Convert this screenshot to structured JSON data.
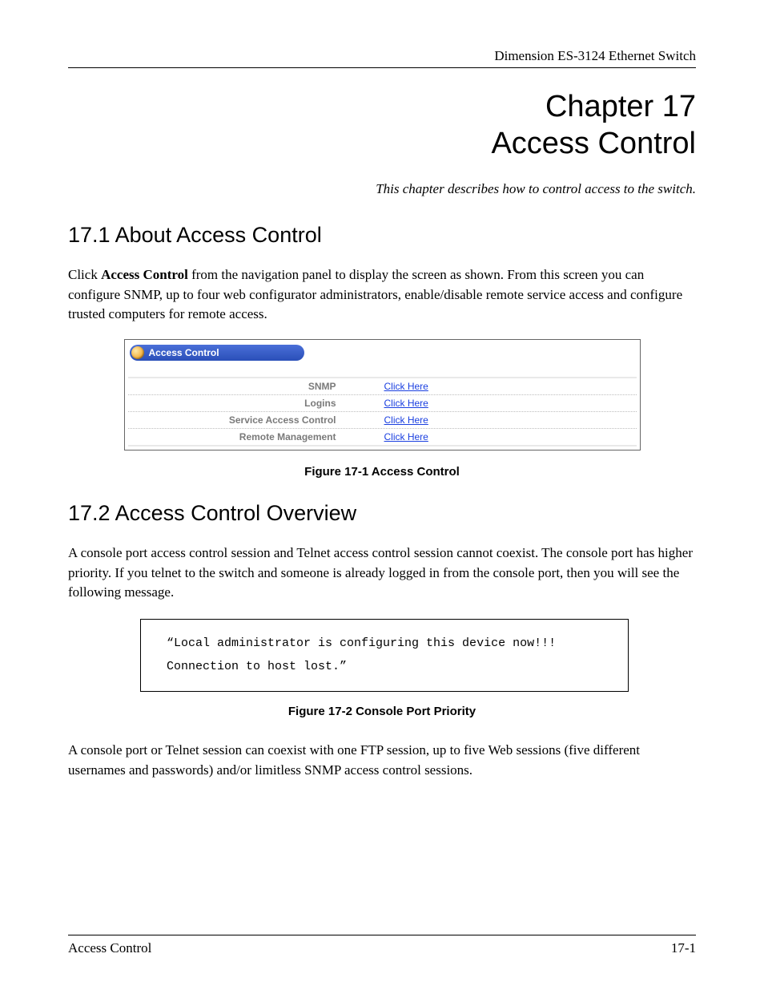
{
  "header": {
    "product": "Dimension ES-3124 Ethernet Switch"
  },
  "chapter": {
    "line1": "Chapter 17",
    "line2": "Access Control",
    "desc": "This chapter describes how to control access to the switch."
  },
  "s171": {
    "heading_no": "17.1",
    "heading_txt": "About Access Control",
    "p1_pre": "Click ",
    "p1_bold": "Access Control",
    "p1_post": " from the navigation panel to display the screen as shown. From this screen you can configure SNMP, up to four web configurator administrators, enable/disable remote service access and configure trusted computers for remote access."
  },
  "fig1": {
    "panel_title": "Access Control",
    "rows": [
      {
        "label": "SNMP",
        "link": "Click Here"
      },
      {
        "label": "Logins",
        "link": "Click Here"
      },
      {
        "label": "Service Access Control",
        "link": "Click Here"
      },
      {
        "label": "Remote Management",
        "link": "Click Here"
      }
    ],
    "caption": "Figure 17-1 Access Control"
  },
  "s172": {
    "heading_no": "17.2",
    "heading_txt": "Access Control Overview",
    "p1": "A console port access control session and Telnet access control session cannot coexist. The console port has higher priority. If you telnet to the switch and someone is already logged in from the console port, then you will see the following message."
  },
  "fig2": {
    "line1": "“Local administrator is configuring this device now!!!",
    "line2": "Connection to host lost.”",
    "caption": "Figure 17-2 Console Port Priority"
  },
  "p_after": "A console port or Telnet session can coexist with one FTP session, up to five Web sessions (five different usernames and passwords) and/or limitless SNMP access control sessions.",
  "footer": {
    "left": "Access Control",
    "right": "17-1"
  }
}
